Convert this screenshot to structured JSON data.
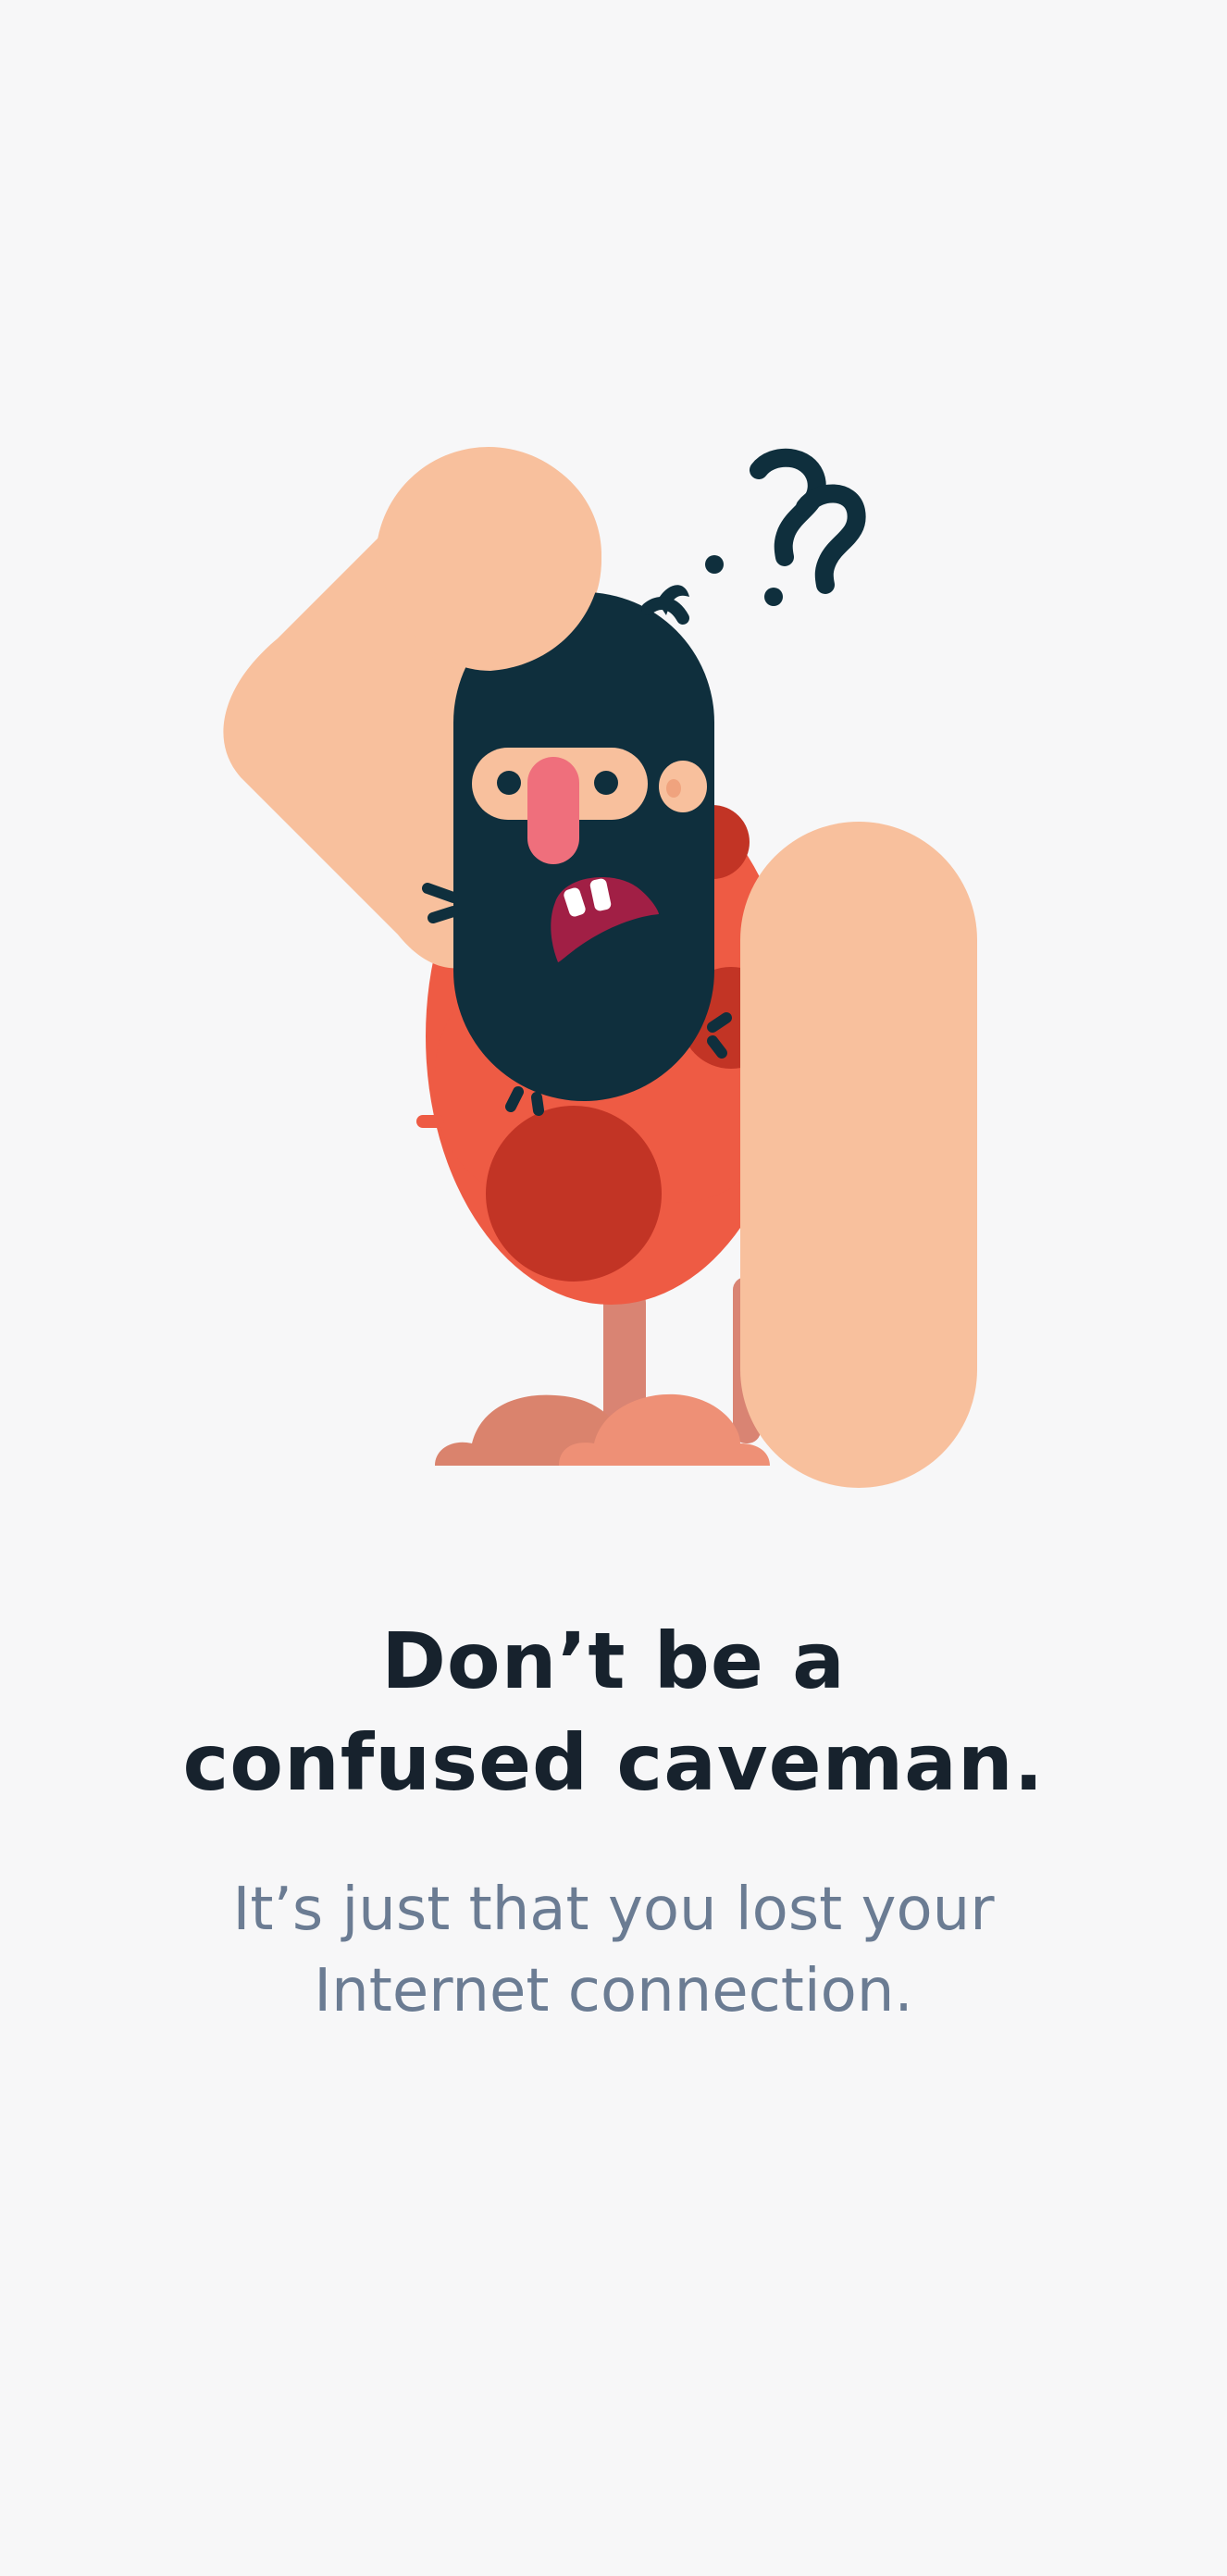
{
  "illustration": {
    "name": "confused-caveman",
    "question_marks": "??",
    "colors": {
      "skin": "#f8c09d",
      "beard": "#0f2f3d",
      "tunic": "#ee5b44",
      "tunic_spot": "#c23425",
      "nose": "#ef6f7c",
      "mouth": "#a11f45",
      "legs": "#d98473",
      "feet": "#ee9076",
      "background": "#f7f7f8"
    }
  },
  "message": {
    "title_line1": "Don’t be a",
    "title_line2": "confused caveman.",
    "subtitle_line1": "It’s just that you lost your",
    "subtitle_line2": "Internet connection."
  }
}
